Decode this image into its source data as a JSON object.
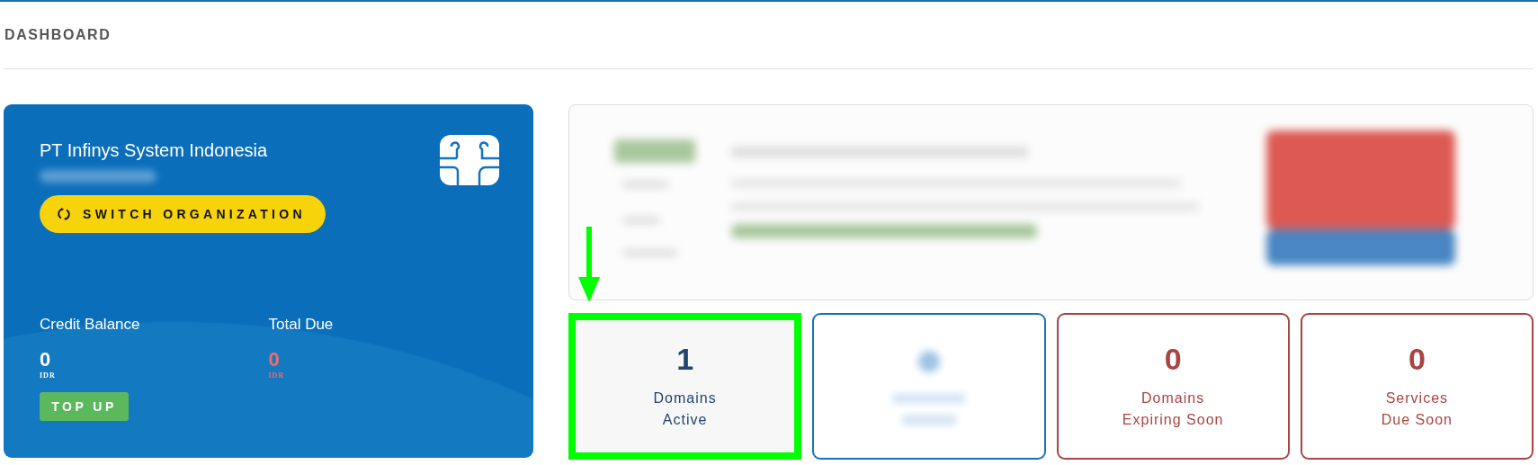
{
  "header": {
    "title": "DASHBOARD"
  },
  "account": {
    "organization": "PT Infinys System Indonesia",
    "switch_button": "SWITCH ORGANIZATION",
    "top_up_button": "TOP UP",
    "balances": [
      {
        "label": "Credit Balance",
        "amount": "0",
        "currency": "IDR",
        "kind": "credit"
      },
      {
        "label": "Total Due",
        "amount": "0",
        "currency": "IDR",
        "kind": "due"
      }
    ]
  },
  "stats": [
    {
      "kind": "highlighted",
      "value": "1",
      "lines": [
        "Domains",
        "Active"
      ]
    },
    {
      "kind": "blurred"
    },
    {
      "kind": "warning",
      "value": "0",
      "lines": [
        "Domains",
        "Expiring Soon"
      ]
    },
    {
      "kind": "warning",
      "value": "0",
      "lines": [
        "Services",
        "Due Soon"
      ]
    }
  ]
}
